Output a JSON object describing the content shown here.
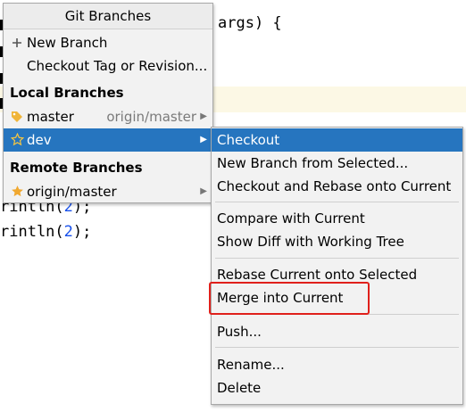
{
  "editor": {
    "code_top": "args) {",
    "line1_prefix": "rintln(",
    "line1_num": "2",
    "line1_suffix": ");",
    "line2_prefix": "rintln(",
    "line2_num": "2",
    "line2_suffix": ");"
  },
  "popup": {
    "title": "Git Branches",
    "new_branch": "New Branch",
    "checkout_tag": "Checkout Tag or Revision...",
    "local_header": "Local Branches",
    "local": [
      {
        "name": "master",
        "tracking": "origin/master",
        "icon": "tag-icon"
      },
      {
        "name": "dev",
        "tracking": "",
        "icon": "star-outline-icon"
      }
    ],
    "remote_header": "Remote Branches",
    "remote": [
      {
        "name": "origin/master",
        "icon": "star-filled-icon"
      }
    ]
  },
  "submenu": {
    "checkout": "Checkout",
    "new_branch_from_selected": "New Branch from Selected...",
    "checkout_rebase": "Checkout and Rebase onto Current",
    "compare": "Compare with Current",
    "show_diff": "Show Diff with Working Tree",
    "rebase_current": "Rebase Current onto Selected",
    "merge": "Merge into Current",
    "push": "Push...",
    "rename": "Rename...",
    "delete": "Delete"
  },
  "colors": {
    "selection": "#2675bf",
    "highlight_box": "#e0201b",
    "number": "#1750eb"
  }
}
